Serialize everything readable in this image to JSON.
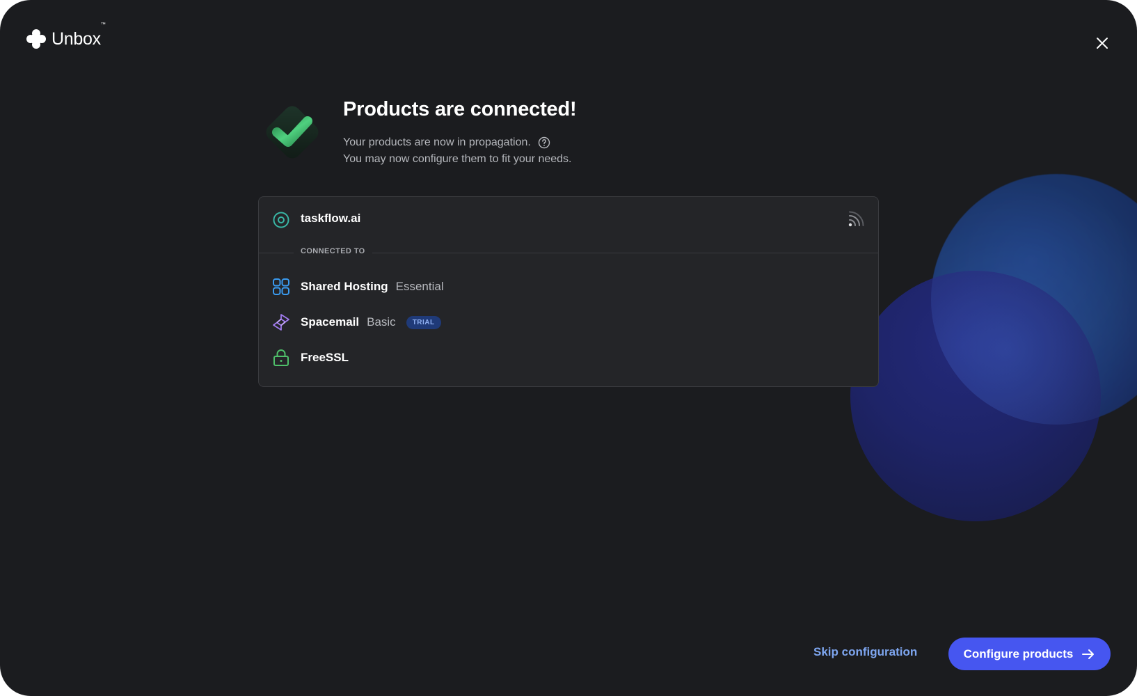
{
  "app": {
    "logo_text": "Unbox",
    "logo_tm": "™"
  },
  "header": {
    "close_icon": "close-icon"
  },
  "hero": {
    "title": "Products are connected!",
    "line1": "Your products are now in propagation.",
    "line2": "You may now configure them to fit your needs.",
    "help_icon": "question-circle-icon"
  },
  "card": {
    "domain": "taskflow.ai",
    "domain_icon": "target-icon",
    "status_icon": "signal-icon",
    "connected_label": "CONNECTED TO",
    "products": [
      {
        "name": "Shared Hosting",
        "plan": "Essential",
        "badge": "",
        "icon": "hosting-icon",
        "color": "#3a9bf0"
      },
      {
        "name": "Spacemail",
        "plan": "Basic",
        "badge": "TRIAL",
        "icon": "spacemail-icon",
        "color": "#a27cf0"
      },
      {
        "name": "FreeSSL",
        "plan": "",
        "badge": "",
        "icon": "lock-icon",
        "color": "#4fc06a"
      }
    ]
  },
  "footer": {
    "skip_label": "Skip configuration",
    "primary_label": "Configure products",
    "primary_icon": "arrow-right-icon"
  },
  "colors": {
    "background": "#1b1c1f",
    "card": "#242528",
    "accent": "#4656f0",
    "link": "#7ea6f0",
    "success": "#3fbf6c"
  }
}
